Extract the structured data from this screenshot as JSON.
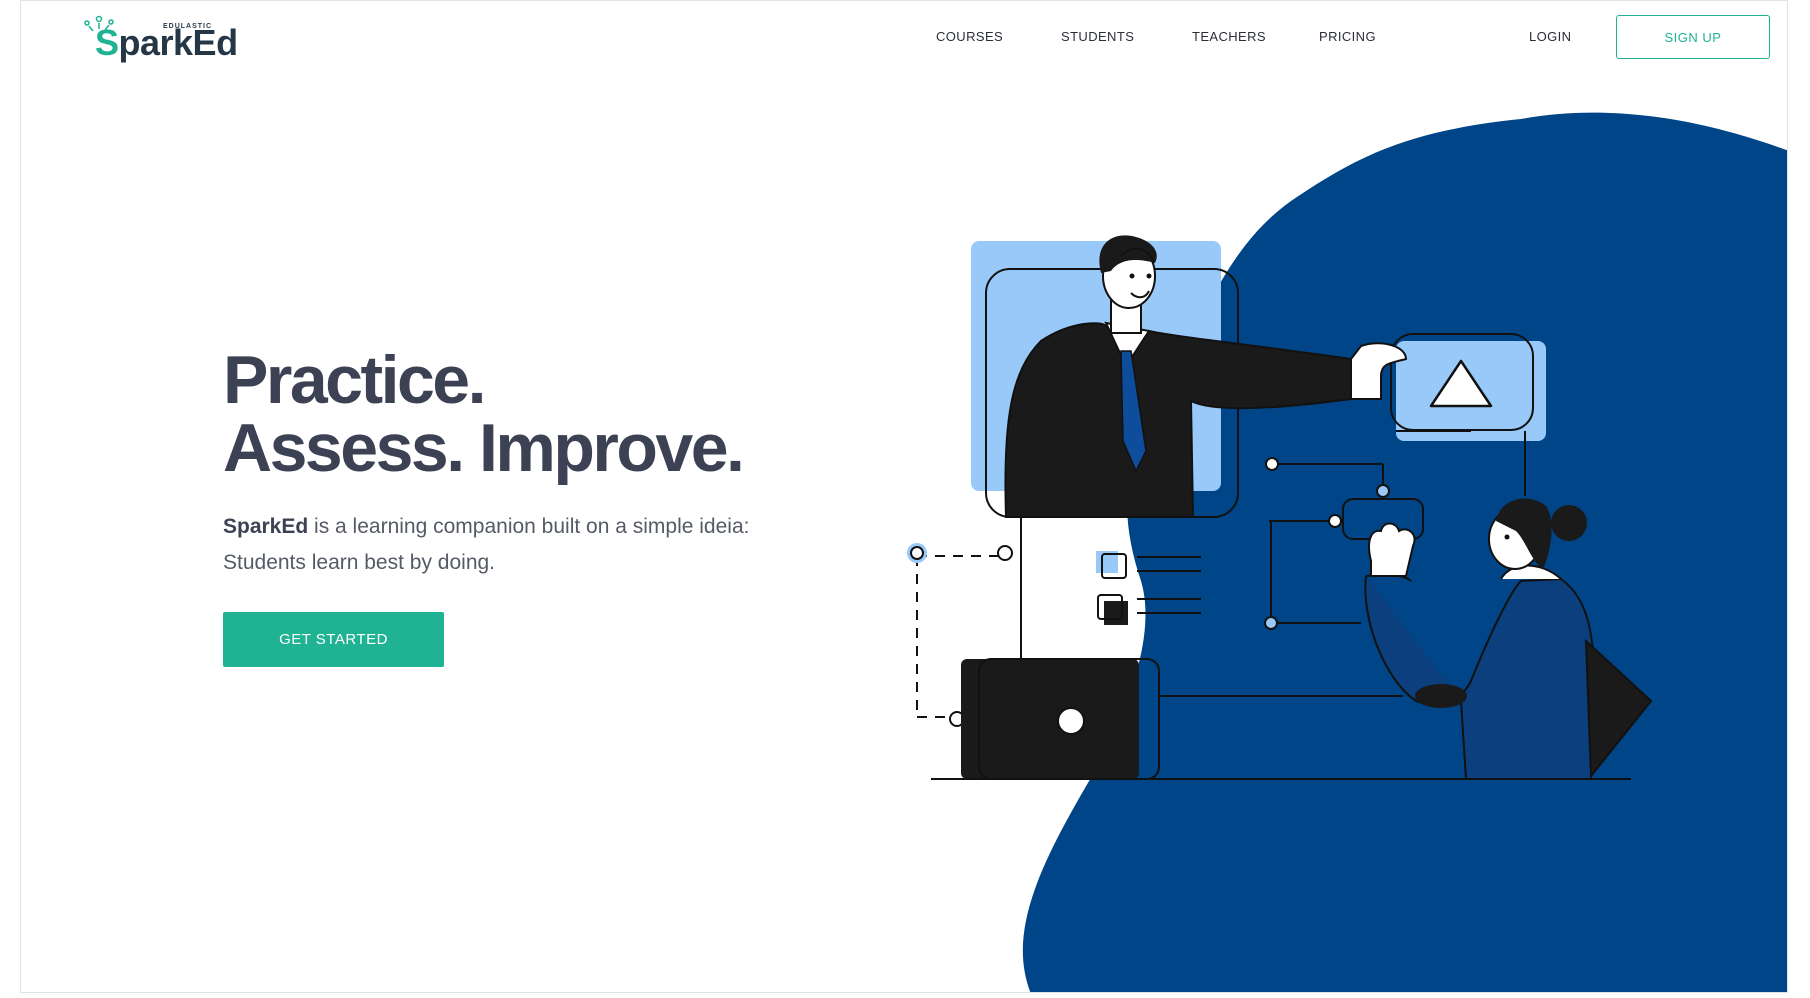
{
  "logo": {
    "tagline": "EDULASTIC",
    "prefix": "S",
    "name": "parkEd"
  },
  "nav": {
    "courses": "COURSES",
    "students": "STUDENTS",
    "teachers": "TEACHERS",
    "pricing": "PRICING",
    "login": "LOGIN",
    "signup": "SIGN UP"
  },
  "hero": {
    "title_line1": "Practice.",
    "title_line2": "Assess. Improve.",
    "desc_brand": "SparkEd",
    "desc_rest": " is a learning companion built on a simple ideia:",
    "desc_line2": "Students learn best by doing.",
    "cta": "GET STARTED"
  },
  "colors": {
    "accent": "#1fb393",
    "blob": "#004587",
    "panel": "#99c9f9",
    "ink": "#1a1a1a"
  },
  "icons": [
    "spark-icon",
    "play-triangle-icon",
    "checkbox-icon"
  ]
}
